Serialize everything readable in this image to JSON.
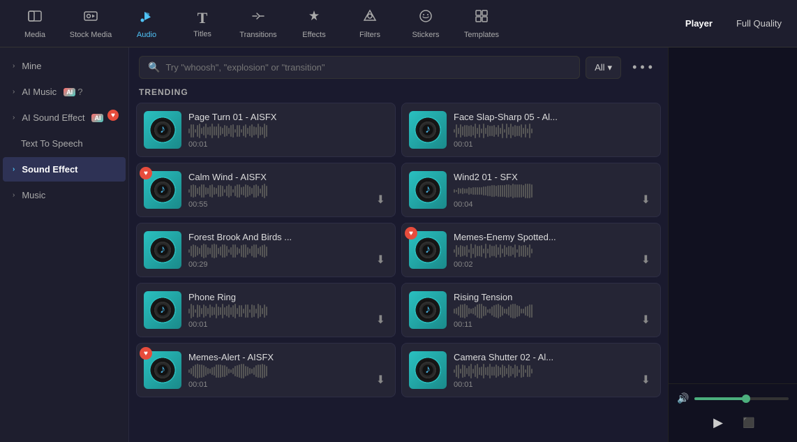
{
  "nav": {
    "items": [
      {
        "id": "media",
        "label": "Media",
        "icon": "🎬",
        "active": false
      },
      {
        "id": "stock-media",
        "label": "Stock Media",
        "icon": "🎞",
        "active": false
      },
      {
        "id": "audio",
        "label": "Audio",
        "icon": "🎵",
        "active": true
      },
      {
        "id": "titles",
        "label": "Titles",
        "icon": "T",
        "active": false
      },
      {
        "id": "transitions",
        "label": "Transitions",
        "icon": "↔",
        "active": false
      },
      {
        "id": "effects",
        "label": "Effects",
        "icon": "✦",
        "active": false
      },
      {
        "id": "filters",
        "label": "Filters",
        "icon": "⬡",
        "active": false
      },
      {
        "id": "stickers",
        "label": "Stickers",
        "icon": "✿",
        "active": false
      },
      {
        "id": "templates",
        "label": "Templates",
        "icon": "▦",
        "active": false
      }
    ],
    "player_label": "Player",
    "full_quality_label": "Full Quality"
  },
  "sidebar": {
    "items": [
      {
        "id": "mine",
        "label": "Mine",
        "has_chevron": true,
        "active": false,
        "badge": null
      },
      {
        "id": "ai-music",
        "label": "AI Music",
        "has_chevron": true,
        "active": false,
        "badge": "ai",
        "has_help": true
      },
      {
        "id": "ai-sound-effect",
        "label": "AI Sound Effect",
        "has_chevron": true,
        "active": false,
        "badge": "ai",
        "has_heart": true
      },
      {
        "id": "text-to-speech",
        "label": "Text To Speech",
        "has_chevron": false,
        "active": false,
        "badge": null
      },
      {
        "id": "sound-effect",
        "label": "Sound Effect",
        "has_chevron": true,
        "active": true,
        "badge": null
      },
      {
        "id": "music",
        "label": "Music",
        "has_chevron": true,
        "active": false,
        "badge": null
      }
    ]
  },
  "search": {
    "placeholder": "Try \"whoosh\", \"explosion\" or \"transition\"",
    "filter_label": "All",
    "filter_icon": "▾"
  },
  "section": {
    "trending_label": "TRENDING"
  },
  "cards": [
    {
      "id": "page-turn",
      "title": "Page Turn 01 - AISFX",
      "duration": "00:01",
      "has_heart": false,
      "has_download": false
    },
    {
      "id": "face-slap",
      "title": "Face Slap-Sharp 05 - Al...",
      "duration": "00:01",
      "has_heart": false,
      "has_download": false
    },
    {
      "id": "calm-wind",
      "title": "Calm Wind - AISFX",
      "duration": "00:55",
      "has_heart": true,
      "has_download": true
    },
    {
      "id": "wind2",
      "title": "Wind2 01 - SFX",
      "duration": "00:04",
      "has_heart": false,
      "has_download": true
    },
    {
      "id": "forest-brook",
      "title": "Forest Brook And Birds ...",
      "duration": "00:29",
      "has_heart": false,
      "has_download": true
    },
    {
      "id": "memes-enemy",
      "title": "Memes-Enemy Spotted...",
      "duration": "00:02",
      "has_heart": true,
      "has_download": true
    },
    {
      "id": "phone-ring",
      "title": "Phone Ring",
      "duration": "00:01",
      "has_heart": false,
      "has_download": true
    },
    {
      "id": "rising-tension",
      "title": "Rising Tension",
      "duration": "00:11",
      "has_heart": false,
      "has_download": true
    },
    {
      "id": "memes-alert",
      "title": "Memes-Alert - AISFX",
      "duration": "00:01",
      "has_heart": true,
      "has_download": true
    },
    {
      "id": "camera-shutter",
      "title": "Camera Shutter 02 - Al...",
      "duration": "00:01",
      "has_heart": false,
      "has_download": true
    }
  ],
  "player": {
    "volume_percent": 55,
    "play_icon": "▶",
    "stop_icon": "■"
  },
  "icons": {
    "search": "🔍",
    "chevron_down": "▾",
    "chevron_right": "›",
    "download": "⬇",
    "heart": "♥",
    "more": "•••",
    "music_note": "♪",
    "collapse": "‹"
  }
}
